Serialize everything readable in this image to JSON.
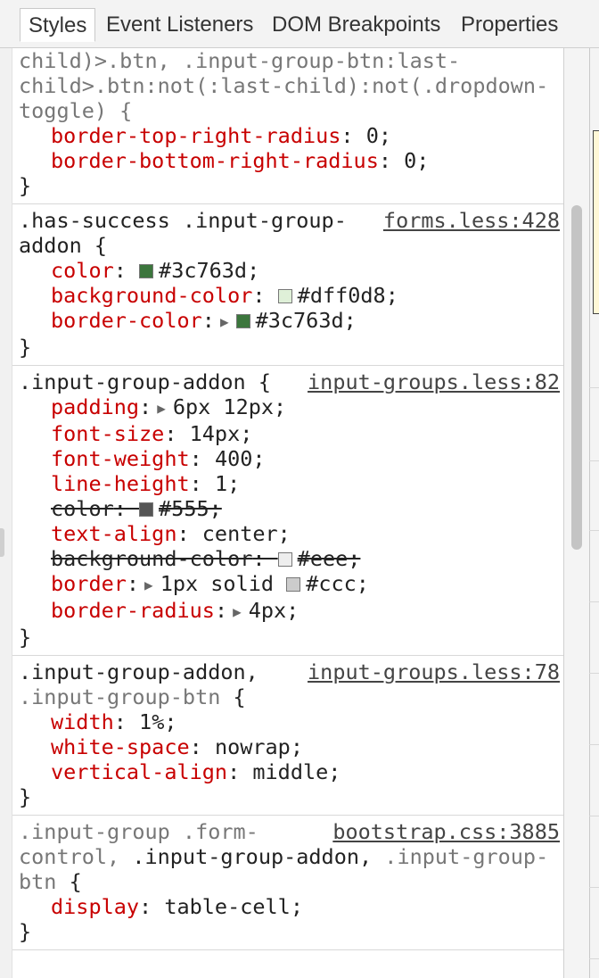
{
  "tabs": [
    {
      "label": "Styles",
      "active": true
    },
    {
      "label": "Event Listeners",
      "active": false
    },
    {
      "label": "DOM Breakpoints",
      "active": false
    },
    {
      "label": "Properties",
      "active": false
    }
  ],
  "rules": {
    "r1": {
      "sel1": "child)>.btn, .input-group-btn:last-",
      "sel2": "child>.btn:not(:last-child):not(.dropdown-",
      "sel3": "toggle) {",
      "p1_name": "border-top-right-radius",
      "p1_val": "0;",
      "p2_name": "border-bottom-right-radius",
      "p2_val": "0;",
      "close": "}"
    },
    "r2": {
      "sel1": ".has-success .input-group-",
      "sel2": "addon {",
      "source": "forms.less:428",
      "p1_name": "color",
      "p1_val": "#3c763d;",
      "p1_color": "#3c763d",
      "p2_name": "background-color",
      "p2_val": "#dff0d8;",
      "p2_color": "#dff0d8",
      "p3_name": "border-color",
      "p3_val": "#3c763d;",
      "p3_color": "#3c763d",
      "close": "}"
    },
    "r3": {
      "sel1": ".input-group-addon {",
      "source": "input-groups.less:82",
      "p1_name": "padding",
      "p1_val": "6px 12px;",
      "p2_name": "font-size",
      "p2_val": "14px;",
      "p3_name": "font-weight",
      "p3_val": "400;",
      "p4_name": "line-height",
      "p4_val": "1;",
      "p5_name": "color",
      "p5_val": "#555;",
      "p5_color": "#555555",
      "p6_name": "text-align",
      "p6_val": "center;",
      "p7_name": "background-color",
      "p7_val": "#eee;",
      "p7_color": "#eeeeee",
      "p8_name": "border",
      "p8_val_a": "1px solid ",
      "p8_val_b": "#ccc;",
      "p8_color": "#cccccc",
      "p9_name": "border-radius",
      "p9_val": "4px;",
      "close": "}"
    },
    "r4": {
      "sel1": ".input-group-addon,",
      "sel2_dim": ".input-group-btn",
      "sel2_rest": " {",
      "source": "input-groups.less:78",
      "p1_name": "width",
      "p1_val": "1%;",
      "p2_name": "white-space",
      "p2_val": "nowrap;",
      "p3_name": "vertical-align",
      "p3_val": "middle;",
      "close": "}"
    },
    "r5": {
      "sel1_dim": ".input-group .form-",
      "sel2_dim": "control,",
      "sel2_match": " .input-group-addon,",
      "sel2_dim2": " .input-group-",
      "sel3_dim": "btn",
      "sel3_rest": " {",
      "source": "bootstrap.css:3885",
      "p1_name": "display",
      "p1_val": "table-cell;",
      "close": "}"
    }
  },
  "colors": {
    "property_name": "#c80000",
    "success_text": "#3c763d",
    "success_bg": "#dff0d8"
  }
}
